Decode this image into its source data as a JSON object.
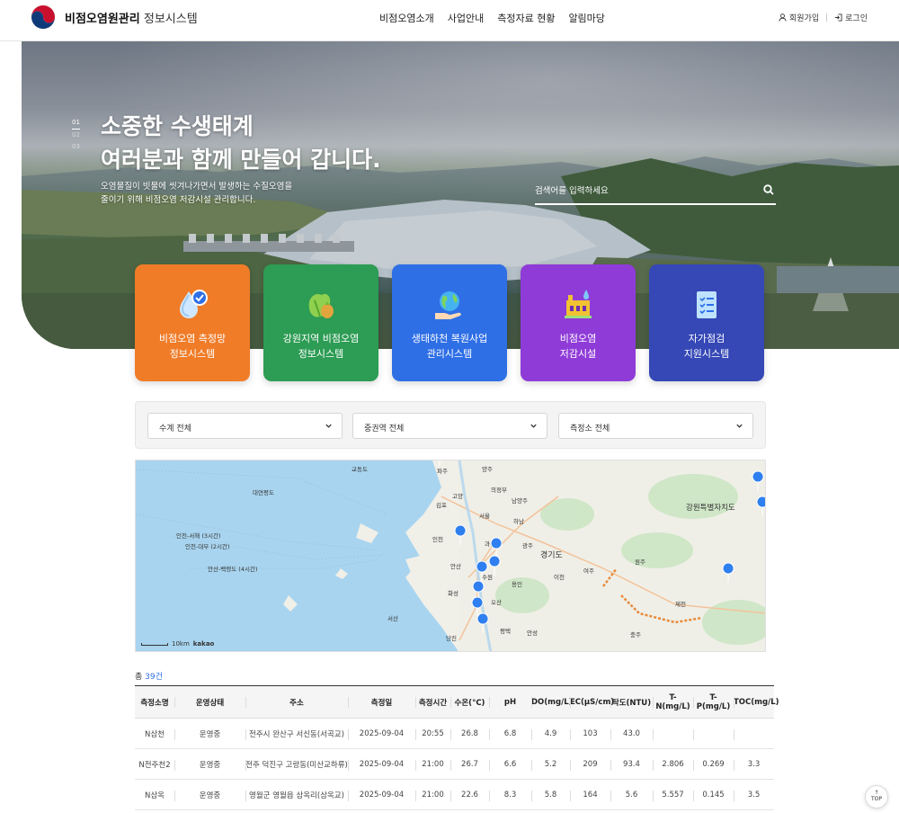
{
  "header": {
    "brand_bold": "비점오염원관리",
    "brand_light": "정보시스템",
    "nav": [
      "비점오염소개",
      "사업안내",
      "측정자료 현황",
      "알림마당"
    ],
    "signup": "회원가입",
    "login": "로그인"
  },
  "hero": {
    "pager": [
      "01",
      "02",
      "03"
    ],
    "title_line1": "소중한 수생태계",
    "title_line2": "여러분과 함께 만들어 갑니다.",
    "sub_line1": "오염물질이 빗물에 씻겨나가면서 발생하는 수질오염을",
    "sub_line2": "줄이기 위해 비점오염 저감시설 관리합니다.",
    "search_placeholder": "검색어를 입력하세요"
  },
  "cards": [
    {
      "line1": "비점오염 측정망",
      "line2": "정보시스템",
      "icon": "water-drop-icon",
      "color": "#f07c28"
    },
    {
      "line1": "강원지역 비점오염",
      "line2": "정보시스템",
      "icon": "vegetable-icon",
      "color": "#2d9c54"
    },
    {
      "line1": "생태하천 복원사업",
      "line2": "관리시스템",
      "icon": "globe-hand-icon",
      "color": "#2f6fe6"
    },
    {
      "line1": "비점오염",
      "line2": "저감시설",
      "icon": "factory-icon",
      "color": "#8f3bd8"
    },
    {
      "line1": "자가점검",
      "line2": "지원시스템",
      "icon": "checklist-icon",
      "color": "#3548b6"
    }
  ],
  "filters": {
    "water_system": "수계 전체",
    "mid_basin": "중권역 전체",
    "station": "측정소 전체"
  },
  "map": {
    "labels": [
      "교동도",
      "파주",
      "양주",
      "의정부",
      "남양주",
      "고양",
      "김포",
      "서울",
      "하남",
      "인천",
      "과천",
      "광주",
      "안산",
      "수원",
      "용인",
      "이천",
      "여주",
      "화성",
      "오산",
      "평택",
      "안성",
      "경기도",
      "원주",
      "강원특별자치도",
      "제천",
      "충주",
      "당진",
      "서산",
      "대연평도",
      "인천-서해 (3시간)",
      "인천-대부 (2시간)",
      "안산-백령도 (4시간)"
    ],
    "credit": "kakao",
    "scale": "10km"
  },
  "table": {
    "total_prefix": "총",
    "total_count": "39",
    "total_suffix": "건",
    "headers": [
      "측정소명",
      "운영상태",
      "주소",
      "측정일",
      "측정시간",
      "수온(°C)",
      "pH",
      "DO(mg/L)",
      "EC(μS/cm)",
      "탁도(NTU)",
      "T-N(mg/L)",
      "T-P(mg/L)",
      "TOC(mg/L)"
    ],
    "rows": [
      [
        "N삼천",
        "운영중",
        "전주시 완산구 서신동(서곡교)",
        "2025-09-04",
        "20:55",
        "26.8",
        "6.8",
        "4.9",
        "103",
        "43.0",
        "",
        "",
        ""
      ],
      [
        "N전주천2",
        "운영중",
        "전주 덕진구 고랑동(미산교하류)",
        "2025-09-04",
        "21:00",
        "26.7",
        "6.6",
        "5.2",
        "209",
        "93.4",
        "2.806",
        "0.269",
        "3.3"
      ],
      [
        "N삼옥",
        "운영중",
        "영월군 영월읍 삼옥리(삼옥교)",
        "2025-09-04",
        "21:00",
        "22.6",
        "8.3",
        "5.8",
        "164",
        "5.6",
        "5.557",
        "0.145",
        "3.5"
      ]
    ]
  },
  "top_button": "TOP"
}
